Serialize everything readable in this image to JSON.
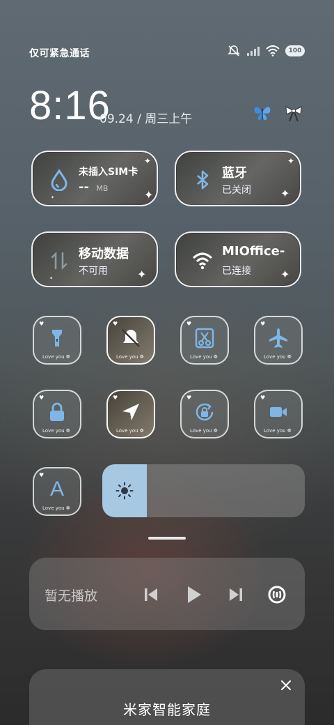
{
  "status_bar": {
    "carrier_text": "仅可紧急通话",
    "battery": "100"
  },
  "header": {
    "time": "8:16",
    "date": "09.24 / 周三上午"
  },
  "big_tiles": {
    "sim": {
      "title": "未插入SIM卡",
      "value": "--",
      "unit": "MB"
    },
    "bluetooth": {
      "title": "蓝牙",
      "status": "已关闭"
    },
    "mobile_data": {
      "title": "移动数据",
      "status": "不可用"
    },
    "wifi": {
      "title": "MIOffice-",
      "status": "已连接"
    }
  },
  "small_tiles": {
    "tile_label": "Love you",
    "items": [
      {
        "icon": "flashlight-icon",
        "active": false
      },
      {
        "icon": "silent-bell-icon",
        "active": true
      },
      {
        "icon": "screenshot-scissors-icon",
        "active": false
      },
      {
        "icon": "airplane-icon",
        "active": false
      },
      {
        "icon": "lock-icon",
        "active": false
      },
      {
        "icon": "location-icon",
        "active": true
      },
      {
        "icon": "rotation-lock-icon",
        "active": false
      },
      {
        "icon": "video-camera-icon",
        "active": false
      },
      {
        "icon": "font-size-icon",
        "active": false,
        "text": "A"
      }
    ]
  },
  "brightness": {
    "level": 0.22
  },
  "media": {
    "label": "暂无播放"
  },
  "smart_home": {
    "title": "米家智能家庭"
  },
  "colors": {
    "accent": "#a7c8e2",
    "icon_blue": "#7fb6e6"
  }
}
